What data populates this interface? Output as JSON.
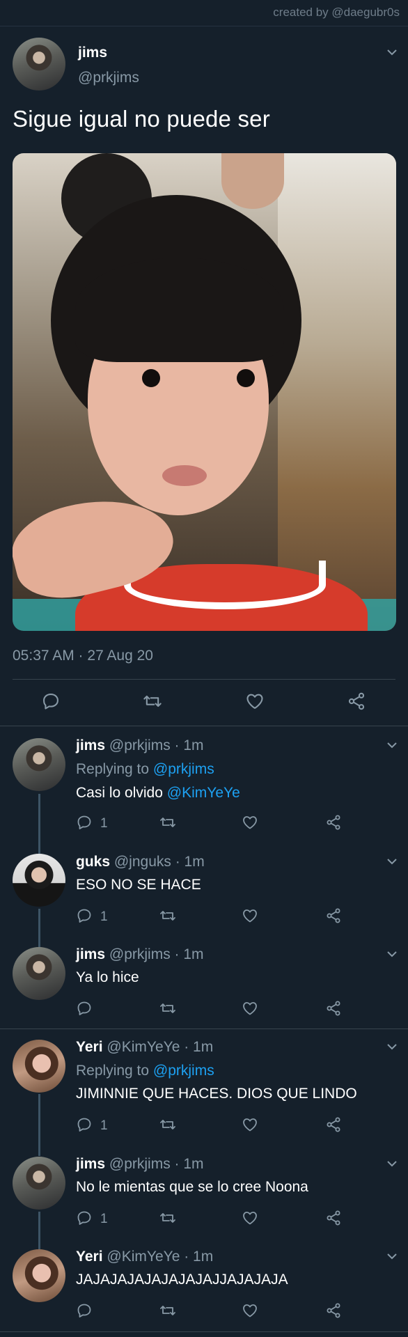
{
  "credit": "created by @daegubr0s",
  "main": {
    "name": "jims",
    "handle": "@prkjims",
    "text": "Sigue igual no puede ser",
    "timestamp": "05:37 AM · 27 Aug 20"
  },
  "replies": [
    {
      "name": "jims",
      "meta": "@prkjims · 1m",
      "replying_label": "Replying to",
      "replying_to": "@prkjims",
      "text": "Casi lo olvido",
      "mention": "@KimYeYe",
      "reply_count": "1"
    },
    {
      "name": "guks",
      "meta": "@jnguks · 1m",
      "text": "ESO NO SE HACE",
      "reply_count": "1"
    },
    {
      "name": "jims",
      "meta": "@prkjims · 1m",
      "text": "Ya lo hice",
      "reply_count": ""
    },
    {
      "name": "Yeri",
      "meta": "@KimYeYe · 1m",
      "replying_label": "Replying to",
      "replying_to": "@prkjims",
      "text": "JIMINNIE QUE HACES. DIOS QUE LINDO",
      "reply_count": "1"
    },
    {
      "name": "jims",
      "meta": "@prkjims · 1m",
      "text": "No le mientas que se lo cree Noona",
      "reply_count": "1"
    },
    {
      "name": "Yeri",
      "meta": "@KimYeYe · 1m",
      "text": "JAJAJAJAJAJAJAJAJJAJAJAJA",
      "reply_count": ""
    }
  ],
  "icons": [
    "chevron-down-icon",
    "reply-icon",
    "retweet-icon",
    "like-icon",
    "share-icon"
  ],
  "colors": {
    "background": "#15202b",
    "link": "#1da1f2",
    "secondary_text": "#8899a6",
    "divider": "#38444d"
  }
}
